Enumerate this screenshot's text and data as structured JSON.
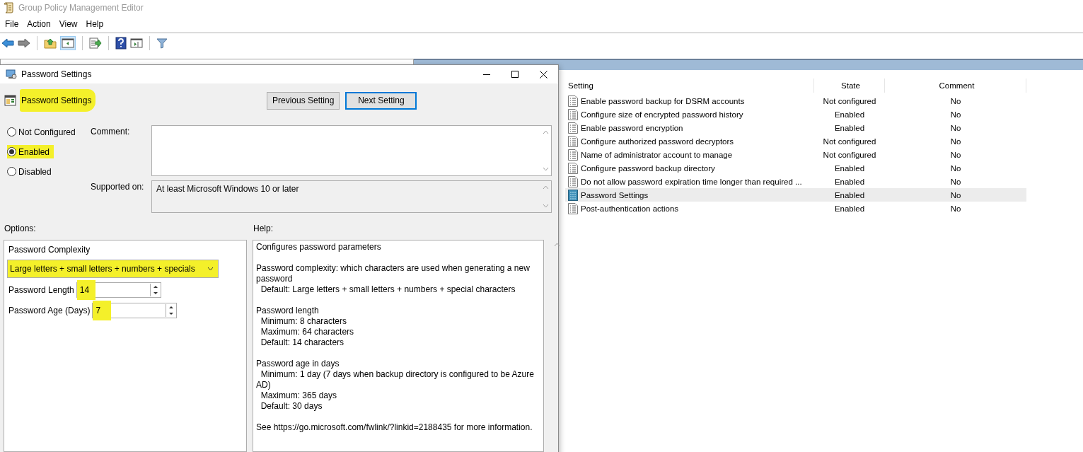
{
  "window": {
    "title": "Group Policy Management Editor"
  },
  "menu": [
    "File",
    "Action",
    "View",
    "Help"
  ],
  "dialog": {
    "title": "Password Settings",
    "heading": {
      "text": "Password Settings",
      "highlighted": true
    },
    "buttons": [
      {
        "label": "Previous Setting",
        "focused": false
      },
      {
        "label": "Next Setting",
        "focused": true
      }
    ],
    "radios": [
      {
        "label": "Not Configured",
        "selected": false,
        "highlighted": false
      },
      {
        "label": "Enabled",
        "selected": true,
        "highlighted": true
      },
      {
        "label": "Disabled",
        "selected": false,
        "highlighted": false
      }
    ],
    "comment_label": "Comment:",
    "supported_label": "Supported on:",
    "supported_value": "At least Microsoft Windows 10 or later",
    "options_label": "Options:",
    "help_label": "Help:",
    "options": [
      {
        "kind": "dropdown",
        "label": "Password Complexity",
        "value": "Large letters + small letters + numbers + specials",
        "highlighted": true
      },
      {
        "kind": "spin",
        "label": "Password Length",
        "value": "14",
        "highlighted": true
      },
      {
        "kind": "spin",
        "label": "Password Age (Days)",
        "value": "7",
        "highlighted": true
      }
    ],
    "help": [
      [
        "Configures password parameters"
      ],
      [
        "Password complexity: which characters are used when generating a new password",
        "  Default: Large letters + small letters + numbers + special characters"
      ],
      [
        "Password length",
        "  Minimum: 8 characters",
        "  Maximum: 64 characters",
        "  Default: 14 characters"
      ],
      [
        "Password age in days",
        "  Minimum: 1 day (7 days when backup directory is configured to be Azure AD)",
        "  Maximum: 365 days",
        "  Default: 30 days"
      ],
      [
        "See https://go.microsoft.com/fwlink/?linkid=2188435 for more information."
      ]
    ]
  },
  "list": {
    "columns": [
      "Setting",
      "State",
      "Comment"
    ],
    "rows": [
      {
        "setting": "Enable password backup for DSRM accounts",
        "state": "Not configured",
        "comment": "No",
        "selected": false
      },
      {
        "setting": "Configure size of encrypted password history",
        "state": "Enabled",
        "comment": "No",
        "selected": false
      },
      {
        "setting": "Enable password encryption",
        "state": "Enabled",
        "comment": "No",
        "selected": false
      },
      {
        "setting": "Configure authorized password decryptors",
        "state": "Not configured",
        "comment": "No",
        "selected": false
      },
      {
        "setting": "Name of administrator account to manage",
        "state": "Not configured",
        "comment": "No",
        "selected": false
      },
      {
        "setting": "Configure password backup directory",
        "state": "Enabled",
        "comment": "No",
        "selected": false
      },
      {
        "setting": "Do not allow password expiration time longer than required ...",
        "state": "Enabled",
        "comment": "No",
        "selected": false
      },
      {
        "setting": "Password Settings",
        "state": "Enabled",
        "comment": "No",
        "selected": true
      },
      {
        "setting": "Post-authentication actions",
        "state": "Enabled",
        "comment": "No",
        "selected": false
      }
    ]
  }
}
